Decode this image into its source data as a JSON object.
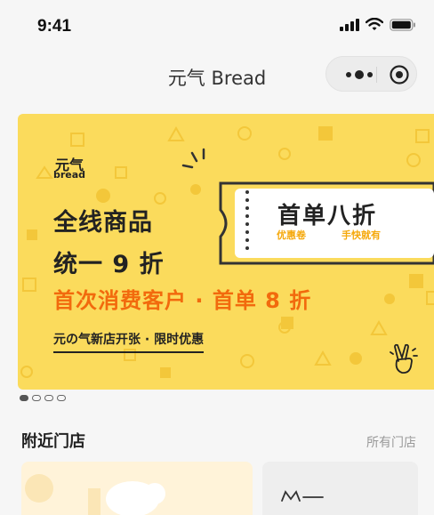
{
  "status": {
    "time": "9:41"
  },
  "nav": {
    "title": "元气 Bread"
  },
  "banner": {
    "logo_cn": "元气",
    "logo_en": "bread",
    "headline_1": "全线商品",
    "headline_2": "统一 9 折",
    "subhead": "首次消费客户 · 首单 8 折",
    "tagline": "元の气新店开张 · 限时优惠",
    "coupon_title": "首单八折",
    "coupon_label_1": "优惠卷",
    "coupon_label_2": "手快就有",
    "colors": {
      "background": "#fbdb5c",
      "accent_orange": "#f26a0d",
      "coupon_label": "#f5a80a"
    }
  },
  "carousel": {
    "page_count": 4,
    "active_index": 0
  },
  "nearby": {
    "title": "附近门店",
    "link": "所有门店"
  }
}
